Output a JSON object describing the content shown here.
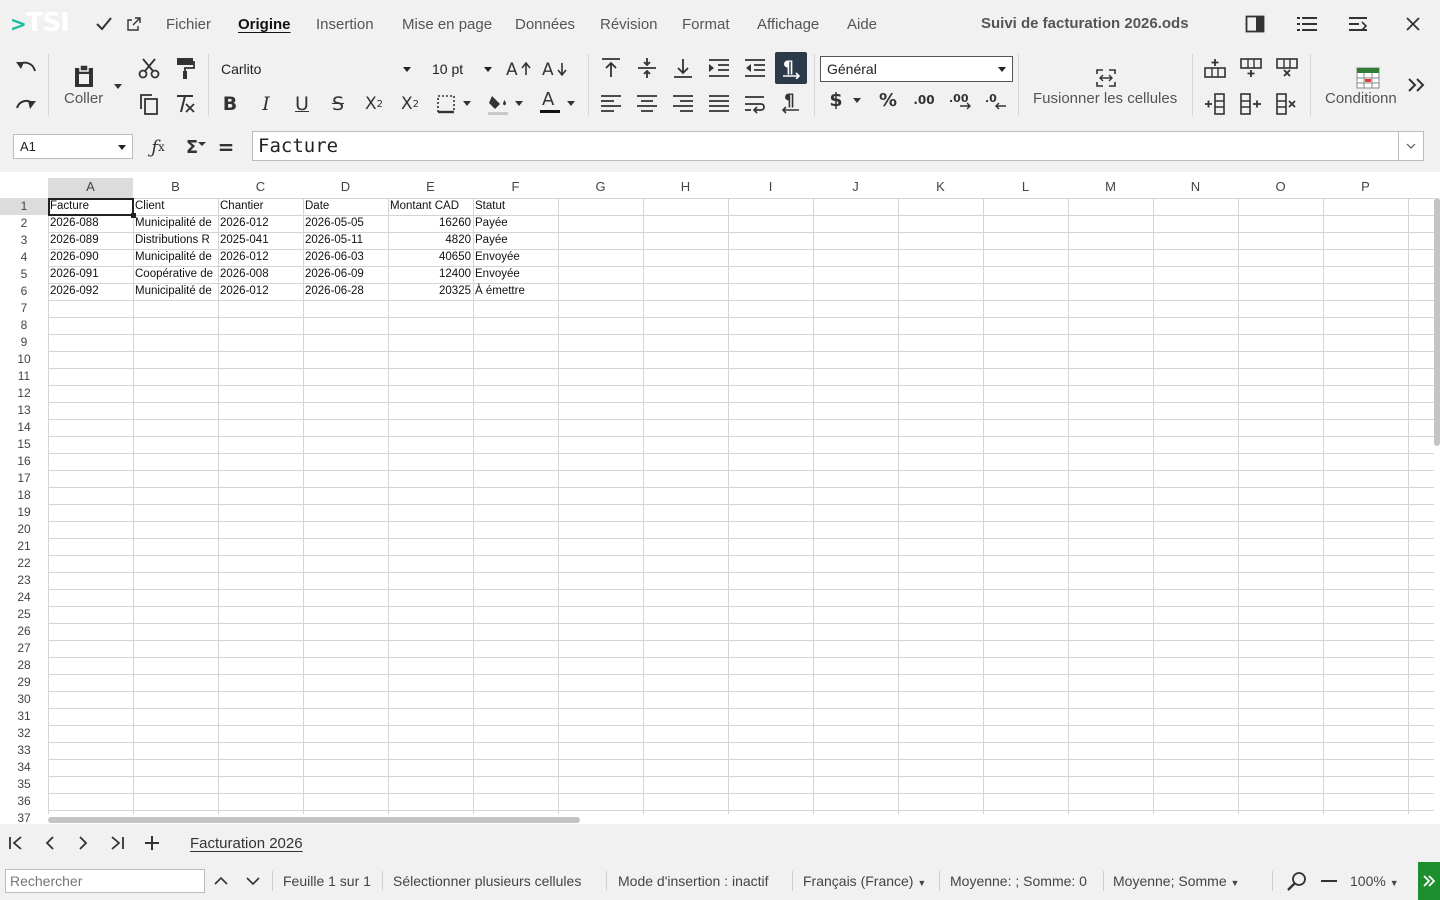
{
  "app": {
    "logo_text": "TSI",
    "document_title": "Suivi de facturation 2026.ods"
  },
  "menu": {
    "items": [
      "Fichier",
      "Origine",
      "Insertion",
      "Mise en page",
      "Données",
      "Révision",
      "Format",
      "Affichage",
      "Aide"
    ],
    "active": "Origine"
  },
  "ribbon": {
    "paste_label": "Coller",
    "font_name": "Carlito",
    "font_size": "10 pt",
    "number_format": "Général",
    "merge_label": "Fusionner les cellules",
    "conditional_label": "Conditionn"
  },
  "formula_bar": {
    "cell_ref": "A1",
    "content": "Facture"
  },
  "grid": {
    "columns": [
      "A",
      "B",
      "C",
      "D",
      "E",
      "F",
      "G",
      "H",
      "I",
      "J",
      "K",
      "L",
      "M",
      "N",
      "O",
      "P"
    ],
    "row_count": 37,
    "header": [
      "Facture",
      "Client",
      "Chantier",
      "Date",
      "Montant CAD",
      "Statut"
    ],
    "rows": [
      [
        "2026-088",
        "Municipalité de",
        "2026-012",
        "2026-05-05",
        "16260",
        "Payée"
      ],
      [
        "2026-089",
        "Distributions R",
        "2025-041",
        "2026-05-11",
        "4820",
        "Payée"
      ],
      [
        "2026-090",
        "Municipalité de",
        "2026-012",
        "2026-06-03",
        "40650",
        "Envoyée"
      ],
      [
        "2026-091",
        "Coopérative de",
        "2026-008",
        "2026-06-09",
        "12400",
        "Envoyée"
      ],
      [
        "2026-092",
        "Municipalité de",
        "2026-012",
        "2026-06-28",
        "20325",
        "À émettre"
      ]
    ]
  },
  "sheets": {
    "tabs": [
      "Facturation 2026"
    ],
    "active": "Facturation 2026"
  },
  "status": {
    "search_placeholder": "Rechercher",
    "sheet_info": "Feuille 1 sur 1",
    "selection_mode": "Sélectionner plusieurs cellules",
    "insert_mode": "Mode d'insertion : inactif",
    "language": "Français (France)",
    "stats": "Moyenne: ; Somme: 0",
    "stats_selector": "Moyenne; Somme",
    "zoom": "100%"
  },
  "colors": {
    "accent": "#1abc9c",
    "toolbar_bg": "#f1f1f1",
    "active_tool": "#2b3a4a",
    "status_green": "#1e8f2e"
  }
}
